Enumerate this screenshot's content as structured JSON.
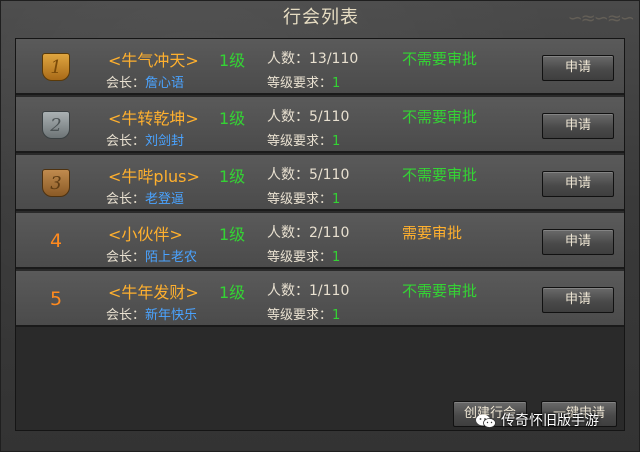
{
  "window": {
    "title": "行会列表"
  },
  "labels": {
    "leader": "会长：",
    "level_requirement": "等级要求："
  },
  "guilds": [
    {
      "rank": "1",
      "name": "<牛气冲天>",
      "leader": "詹心语",
      "level": "1级",
      "members": "人数：13/110",
      "level_req": "1",
      "approval": "不需要审批",
      "approval_color": "#34d334",
      "apply": "申请",
      "badge": "gold"
    },
    {
      "rank": "2",
      "name": "<牛转乾坤>",
      "leader": "刘剑封",
      "level": "1级",
      "members": "人数：5/110",
      "level_req": "1",
      "approval": "不需要审批",
      "approval_color": "#34d334",
      "apply": "申请",
      "badge": "silver"
    },
    {
      "rank": "3",
      "name": "<牛哔plus>",
      "leader": "老登逼",
      "level": "1级",
      "members": "人数：5/110",
      "level_req": "1",
      "approval": "不需要审批",
      "approval_color": "#34d334",
      "apply": "申请",
      "badge": "bronze"
    },
    {
      "rank": "4",
      "name": "<小伙伴>",
      "leader": "陌上老农",
      "level": "1级",
      "members": "人数：2/110",
      "level_req": "1",
      "approval": "需要审批",
      "approval_color": "#ffb02e",
      "apply": "申请",
      "badge": "none"
    },
    {
      "rank": "5",
      "name": "<牛年发财>",
      "leader": "新年快乐",
      "level": "1级",
      "members": "人数：1/110",
      "level_req": "1",
      "approval": "不需要审批",
      "approval_color": "#34d334",
      "apply": "申请",
      "badge": "none"
    }
  ],
  "footer": {
    "create_guild": "创建行会",
    "one_click_apply": "一键申请"
  },
  "watermark": {
    "text": "传奇怀旧版手游"
  },
  "colors": {
    "gold": "#c98a2a",
    "silver": "#8d9496",
    "bronze": "#a0733a",
    "name": "#ffb02e",
    "leader_name": "#4aa3ff",
    "green": "#34d334",
    "rank_number": "#ff8a1e"
  }
}
